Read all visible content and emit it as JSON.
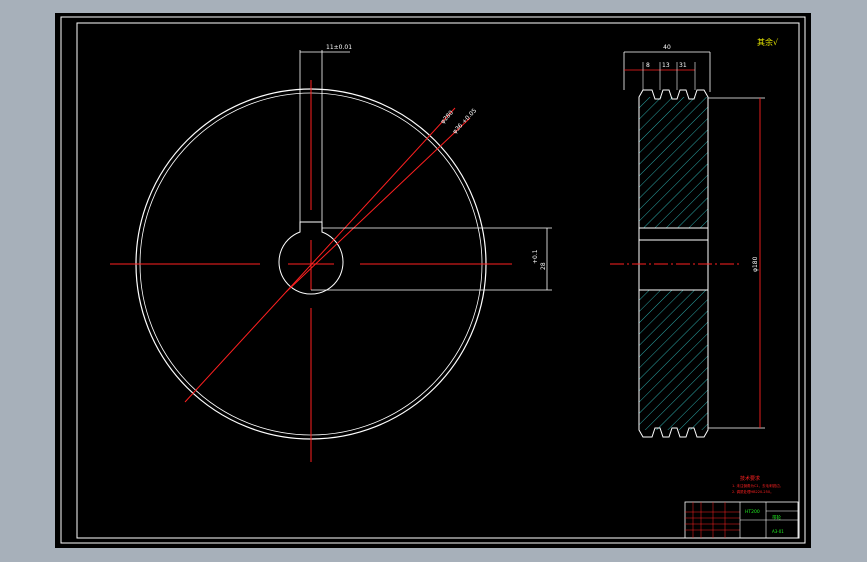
{
  "app": {
    "name": "CAD viewer",
    "colors": {
      "frame_bg": "#a7b0ba",
      "sheet_bg": "#000000",
      "line_white": "#ffffff",
      "line_red": "#ff2020",
      "hatch": "#2aa5a5",
      "green": "#22ee22",
      "yellow": "#e8e800"
    }
  },
  "drawing": {
    "roughness_mark": "其余√",
    "front_view": {
      "keyway_dim": "11±0.01",
      "outer_dim": "φ280",
      "inner_dim": "φ36 +0.05",
      "side_dim": "+0.1",
      "side_dim2": "28"
    },
    "side_view": {
      "overall_width": "40",
      "groove_dims": [
        "8",
        "13",
        "31"
      ],
      "diameter_dim": "φ180"
    },
    "notes": {
      "title": "技术要求",
      "lines": [
        "1. 未注倒角为C1，去毛刺锐边。",
        "2. 调质处理HB220-250。"
      ]
    },
    "title_block": {
      "material": "HT200",
      "part_name": "带轮",
      "drawing_no": "A3-01"
    }
  }
}
